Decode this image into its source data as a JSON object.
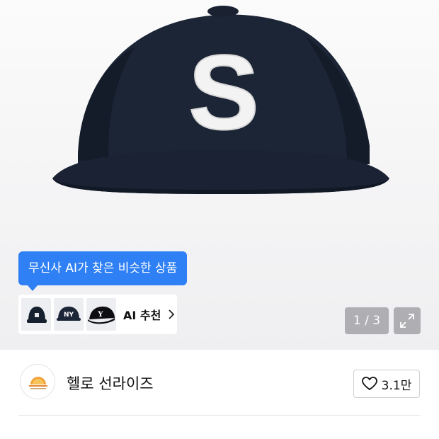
{
  "product_image": {
    "description_icon": "navy-baseball-cap-image",
    "cap_letter": "S",
    "colors": {
      "cap": "#1b2333",
      "letter": "#f3f3f3",
      "accent": "#2f80f5"
    }
  },
  "ai_similar": {
    "tooltip": "무신사 AI가 찾은 비슷한 상품",
    "recommend_label": "AI 추천",
    "thumbnails": [
      {
        "icon": "cap-thumbnail-icon",
        "letter": ""
      },
      {
        "icon": "cap-thumbnail-icon",
        "letter": "NY"
      },
      {
        "icon": "cap-thumbnail-icon",
        "letter": "Y"
      }
    ]
  },
  "gallery": {
    "counter": "1 / 3",
    "expand_icon": "expand-icon"
  },
  "brand": {
    "name": "헬로 선라이즈",
    "logo_icon": "sunrise-logo-icon",
    "likes": "3.1만",
    "like_icon": "heart-icon"
  }
}
